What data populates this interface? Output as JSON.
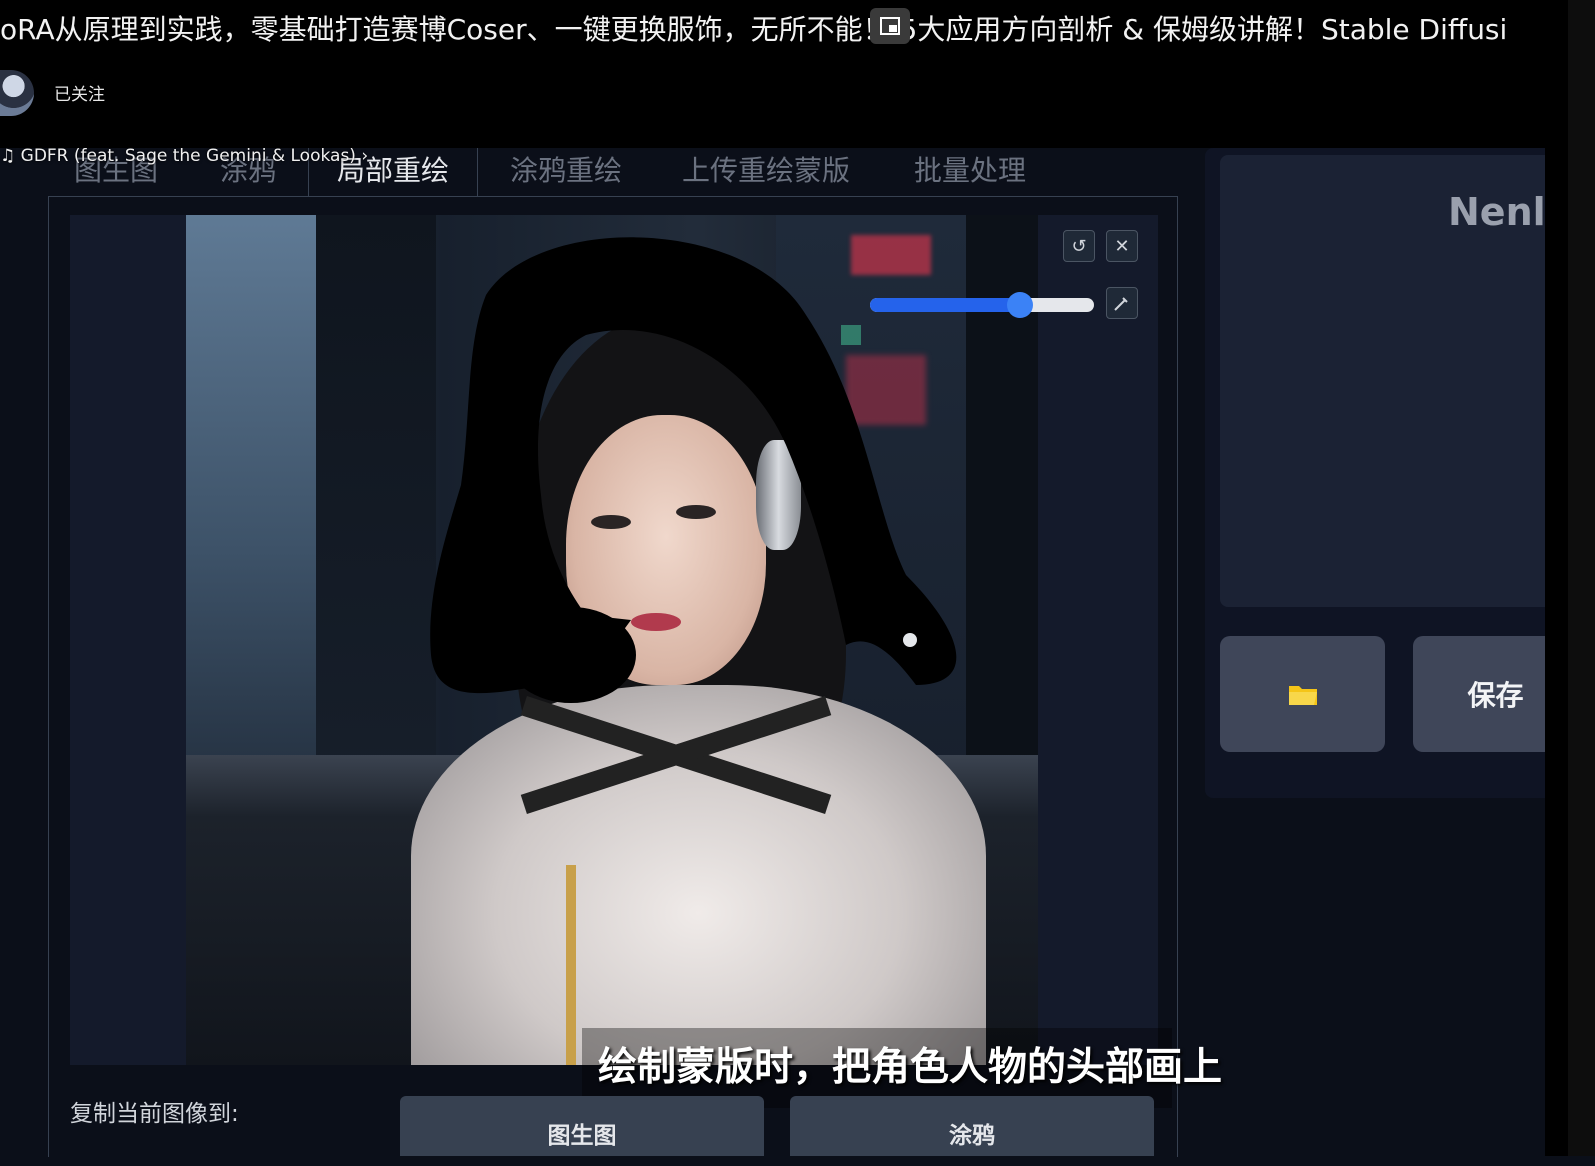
{
  "video": {
    "title": "oRA从原理到实践，零基础打造赛博Coser、一键更换服饰，无所不能！ 5大应用方向剖析 & 保姆级讲解！Stable Diffusi",
    "follow_label": "已关注",
    "music": "♫ GDFR (feat. Sage the Gemini & Lookas) ›",
    "subtitle": "绘制蒙版时，把角色人物的头部画上"
  },
  "tabs": [
    {
      "label": "图生图"
    },
    {
      "label": "涂鸦"
    },
    {
      "label": "局部重绘"
    },
    {
      "label": "涂鸦重绘"
    },
    {
      "label": "上传重绘蒙版"
    },
    {
      "label": "批量处理"
    }
  ],
  "active_tab": "局部重绘",
  "brush": {
    "size_fraction": 0.67
  },
  "icons": {
    "undo": "undo-icon",
    "clear": "close-icon",
    "brush": "brush-icon",
    "folder": "folder-icon",
    "pip": "picture-in-picture-icon"
  },
  "copy_to": {
    "label": "复制当前图像到:",
    "buttons": [
      "图生图",
      "涂鸦"
    ]
  },
  "right_panel": {
    "gallery_text": "Nenly",
    "save_label": "保存"
  },
  "colors": {
    "accent": "#2563eb",
    "panel_bg": "#0b0f19",
    "button_bg": "#3f4659",
    "folder": "#f5c518"
  }
}
